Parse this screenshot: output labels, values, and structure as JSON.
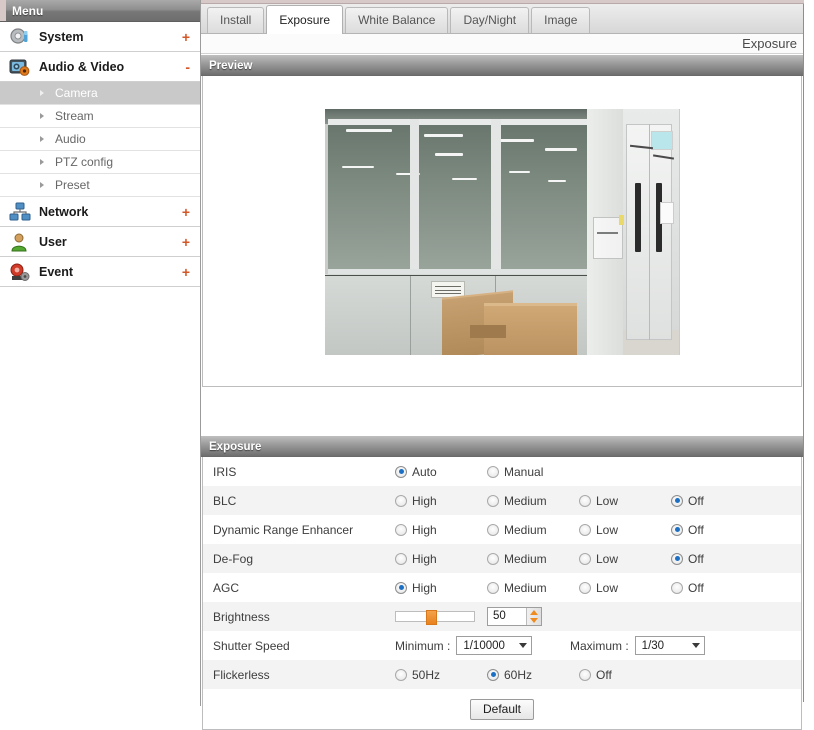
{
  "sidebar": {
    "header": "Menu",
    "items": [
      {
        "label": "System",
        "icon": "camera-system-icon",
        "toggle": "+",
        "expanded": false,
        "children": []
      },
      {
        "label": "Audio & Video",
        "icon": "audio-video-icon",
        "toggle": "-",
        "expanded": true,
        "children": [
          {
            "label": "Camera",
            "active": true
          },
          {
            "label": "Stream",
            "active": false
          },
          {
            "label": "Audio",
            "active": false
          },
          {
            "label": "PTZ config",
            "active": false
          },
          {
            "label": "Preset",
            "active": false
          }
        ]
      },
      {
        "label": "Network",
        "icon": "network-icon",
        "toggle": "+",
        "expanded": false,
        "children": []
      },
      {
        "label": "User",
        "icon": "user-icon",
        "toggle": "+",
        "expanded": false,
        "children": []
      },
      {
        "label": "Event",
        "icon": "event-icon",
        "toggle": "+",
        "expanded": false,
        "children": []
      }
    ]
  },
  "tabs": [
    {
      "label": "Install",
      "active": false
    },
    {
      "label": "Exposure",
      "active": true
    },
    {
      "label": "White Balance",
      "active": false
    },
    {
      "label": "Day/Night",
      "active": false
    },
    {
      "label": "Image",
      "active": false
    }
  ],
  "breadcrumb": "Exposure",
  "preview": {
    "title": "Preview"
  },
  "exposure": {
    "title": "Exposure",
    "rows": {
      "iris": {
        "label": "IRIS",
        "options": [
          "Auto",
          "Manual"
        ],
        "selected": "Auto"
      },
      "blc": {
        "label": "BLC",
        "options": [
          "High",
          "Medium",
          "Low",
          "Off"
        ],
        "selected": "Off"
      },
      "dre": {
        "label": "Dynamic Range Enhancer",
        "options": [
          "High",
          "Medium",
          "Low",
          "Off"
        ],
        "selected": "Off"
      },
      "defog": {
        "label": "De-Fog",
        "options": [
          "High",
          "Medium",
          "Low",
          "Off"
        ],
        "selected": "Off"
      },
      "agc": {
        "label": "AGC",
        "options": [
          "High",
          "Medium",
          "Low",
          "Off"
        ],
        "selected": "High"
      },
      "brightness": {
        "label": "Brightness",
        "value": "50",
        "slider_percent": 45,
        "min": 0,
        "max": 100
      },
      "shutter": {
        "label": "Shutter Speed",
        "min_label": "Minimum :",
        "min_value": "1/10000",
        "max_label": "Maximum :",
        "max_value": "1/30"
      },
      "flickerless": {
        "label": "Flickerless",
        "options": [
          "50Hz",
          "60Hz",
          "Off"
        ],
        "selected": "60Hz"
      }
    }
  },
  "footer": {
    "default_button": "Default"
  },
  "colors": {
    "accent_orange": "#d2582a",
    "radio_selected": "#1b70c6",
    "slider_thumb": "#e8821d",
    "active_subitem_bg": "#c9c9c9"
  }
}
